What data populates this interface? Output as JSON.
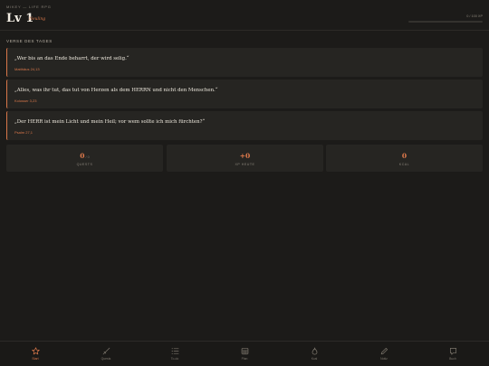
{
  "header": {
    "app_name": "MIKEY — LIFE RPG",
    "level": "Lv 1",
    "rank": "Neuling",
    "xp_text": "0 / 100 XP",
    "xp_progress": 0
  },
  "verses": {
    "title": "VERSE DES TAGES",
    "items": [
      {
        "text": "„Wer bis an das Ende beharrt, der wird selig.“",
        "ref": "Matthäus 24,13"
      },
      {
        "text": "„Alles, was ihr tut, das tut von Herzen als dem HERRN und nicht den Menschen.“",
        "ref": "Kolosser 3,23"
      },
      {
        "text": "„Der HERR ist mein Licht und mein Heil; vor wem sollte ich mich fürchten?“",
        "ref": "Psalm 27,1"
      }
    ]
  },
  "stats": [
    {
      "value": "0",
      "sub": "/ 0",
      "label": "QUESTS"
    },
    {
      "value": "+0",
      "sub": "",
      "label": "XP HEUTE"
    },
    {
      "value": "0",
      "sub": "",
      "label": "KCAL"
    }
  ],
  "nav": {
    "items": [
      {
        "label": "Start",
        "icon": "star-icon"
      },
      {
        "label": "Quests",
        "icon": "sword-icon"
      },
      {
        "label": "To-do",
        "icon": "list-icon"
      },
      {
        "label": "Plan",
        "icon": "calendar-icon"
      },
      {
        "label": "Kcal",
        "icon": "flame-icon"
      },
      {
        "label": "Notiz",
        "icon": "pencil-icon"
      },
      {
        "label": "Buch",
        "icon": "book-icon"
      }
    ],
    "active_index": 0
  },
  "colors": {
    "background": "#1c1b19",
    "card": "#262522",
    "accent": "#d8774a",
    "text": "#e8e2d6",
    "muted": "#8a847a"
  }
}
